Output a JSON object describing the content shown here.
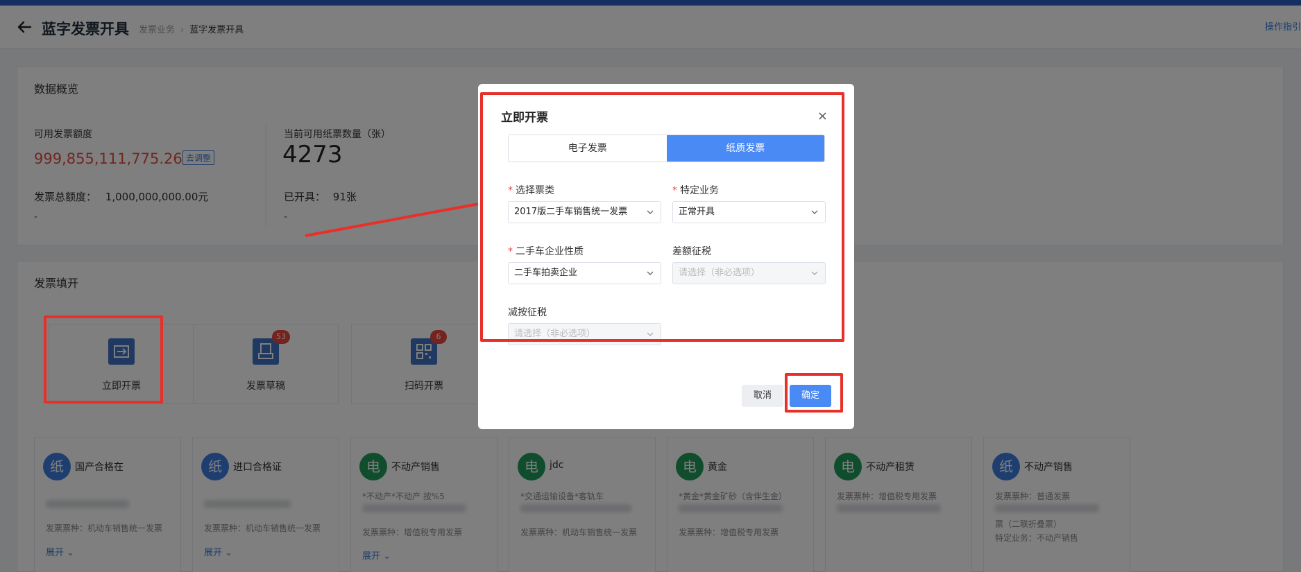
{
  "header": {
    "title": "蓝字发票开具",
    "breadcrumb": [
      "发票业务",
      "蓝字发票开具"
    ],
    "guide_link": "操作指引"
  },
  "overview": {
    "title": "数据概览",
    "available_quota_label": "可用发票额度",
    "available_quota_value": "999,855,111,775.26元",
    "adjust_button": "去调整",
    "total_quota_label": "发票总额度：",
    "total_quota_value": "1,000,000,000.00元",
    "dash_left": "-",
    "paper_count_label": "当前可用纸票数量（张）",
    "paper_count_value": "4273",
    "issued_label": "已开具：",
    "issued_value": "91张",
    "dash_right": "-"
  },
  "fill": {
    "title": "发票填开",
    "tiles": [
      {
        "label": "立即开票"
      },
      {
        "label": "发票草稿",
        "badge": "53"
      },
      {
        "label": "扫码开票",
        "badge": "6"
      }
    ],
    "templates": [
      {
        "mark": "纸",
        "name": "国产合格在",
        "line1": "",
        "type": "发票票种：机动车销售统一发票",
        "expand": "展开"
      },
      {
        "mark": "纸",
        "name": "进口合格证",
        "line1": "",
        "type": "发票票种：机动车销售统一发票",
        "expand": "展开"
      },
      {
        "mark": "电",
        "name": "不动产销售",
        "line1": "*不动产*不动产 按%5",
        "type": "发票票种：增值税专用发票",
        "expand": "展开"
      },
      {
        "mark": "电",
        "name": "jdc",
        "line1": "*交通运输设备*客轨车",
        "type": "发票票种：机动车销售统一发票",
        "expand": ""
      },
      {
        "mark": "电",
        "name": "黄金",
        "line1": "*黄金*黄金矿砂（含伴生金）",
        "type": "发票票种：增值税专用发票",
        "expand": ""
      },
      {
        "mark": "电",
        "name": "不动产租赁",
        "line1": "发票票种：增值税专用发票",
        "type": "",
        "expand": ""
      },
      {
        "mark": "纸",
        "name": "不动产销售",
        "line1": "发票票种：普通发票",
        "type": "票（二联折叠票）",
        "line3": "特定业务：不动产销售",
        "expand": ""
      }
    ]
  },
  "modal": {
    "title": "立即开票",
    "close": "×",
    "tabs": [
      {
        "label": "电子发票",
        "active": false
      },
      {
        "label": "纸质发票",
        "active": true
      }
    ],
    "fields": {
      "ticket_type": {
        "label": "选择票类",
        "value": "2017版二手车销售统一发票"
      },
      "business": {
        "label": "特定业务",
        "value": "正常开具"
      },
      "enterprise": {
        "label": "二手车企业性质",
        "value": "二手车拍卖企业"
      },
      "diff_tax": {
        "label": "差额征税",
        "placeholder": "请选择（非必选项）"
      },
      "reduce_tax": {
        "label": "减按征税",
        "placeholder": "请选择（非必选项）"
      }
    },
    "cancel": "取消",
    "confirm": "确定"
  },
  "colors": {
    "accent": "#4a8af4",
    "brand_bar": "#2b5fc4",
    "amount_red": "#e34d43",
    "annotation_red": "#e8302a",
    "green_mark": "#1f9a5b"
  }
}
